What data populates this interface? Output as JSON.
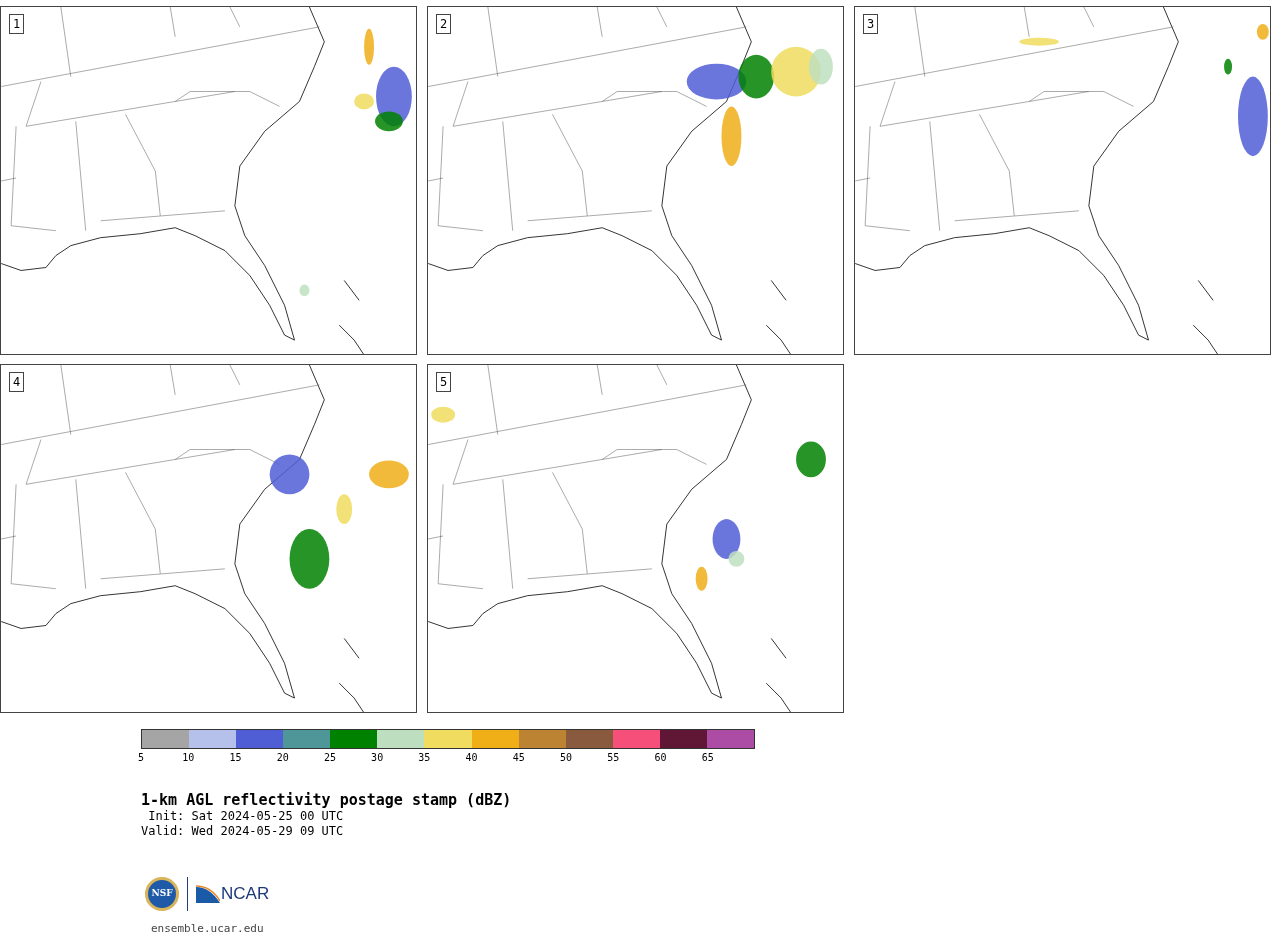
{
  "panels": [
    {
      "number": "1"
    },
    {
      "number": "2"
    },
    {
      "number": "3"
    },
    {
      "number": "4"
    },
    {
      "number": "5"
    }
  ],
  "colorbar": {
    "bins": [
      {
        "color": "#a5a5a5"
      },
      {
        "color": "#b5c1ea"
      },
      {
        "color": "#505ed6"
      },
      {
        "color": "#4f9699"
      },
      {
        "color": "#008100"
      },
      {
        "color": "#bedfbf"
      },
      {
        "color": "#f0dc5e"
      },
      {
        "color": "#f0ae17"
      },
      {
        "color": "#bb8332"
      },
      {
        "color": "#8a5a3e"
      },
      {
        "color": "#f54f7a"
      },
      {
        "color": "#601735"
      },
      {
        "color": "#ad4ca4"
      }
    ],
    "ticks": [
      "5",
      "10",
      "15",
      "20",
      "25",
      "30",
      "35",
      "40",
      "45",
      "50",
      "55",
      "60",
      "65"
    ]
  },
  "title": "1-km AGL reflectivity postage stamp (dBZ)",
  "init": " Init: Sat 2024-05-25 00 UTC",
  "valid": "Valid: Wed 2024-05-29 09 UTC",
  "logos": {
    "nsf": "NSF",
    "ncar": "NCAR"
  },
  "site": "ensemble.ucar.edu"
}
